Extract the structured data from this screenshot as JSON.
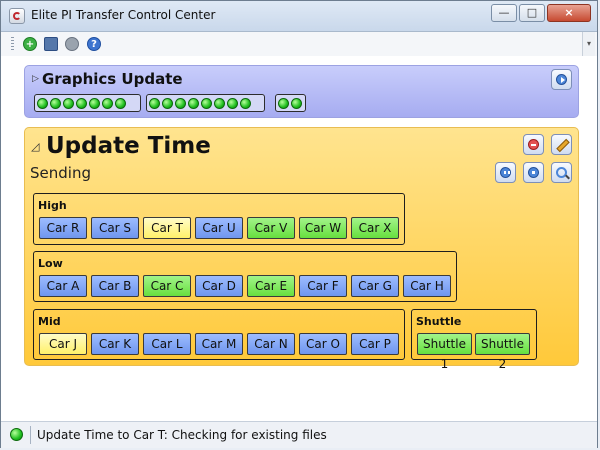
{
  "window": {
    "title": "Elite PI Transfer Control Center",
    "min_label": "—",
    "max_label": "□",
    "close_label": "×"
  },
  "toolbar": {
    "icons": [
      "add-icon",
      "copy-icon",
      "gear-icon",
      "help-icon"
    ],
    "help_glyph": "?",
    "add_glyph": "+"
  },
  "graphics_panel": {
    "title": "Graphics Update",
    "expander_glyph": "▷",
    "dot_groups": [
      7,
      8,
      2
    ],
    "color": "#b0b6f5"
  },
  "update_panel": {
    "title": "Update Time",
    "status": "Sending",
    "expander_glyph": "◿",
    "color": "#ffd24f",
    "groups": {
      "high": {
        "title": "High",
        "cars": [
          {
            "label": "Car R",
            "state": "blue"
          },
          {
            "label": "Car S",
            "state": "blue"
          },
          {
            "label": "Car T",
            "state": "yellow"
          },
          {
            "label": "Car U",
            "state": "blue"
          },
          {
            "label": "Car V",
            "state": "green"
          },
          {
            "label": "Car W",
            "state": "green"
          },
          {
            "label": "Car X",
            "state": "green"
          }
        ]
      },
      "low": {
        "title": "Low",
        "cars": [
          {
            "label": "Car A",
            "state": "blue"
          },
          {
            "label": "Car B",
            "state": "blue"
          },
          {
            "label": "Car C",
            "state": "green"
          },
          {
            "label": "Car D",
            "state": "blue"
          },
          {
            "label": "Car E",
            "state": "green"
          },
          {
            "label": "Car F",
            "state": "blue"
          },
          {
            "label": "Car G",
            "state": "blue"
          },
          {
            "label": "Car H",
            "state": "blue"
          }
        ]
      },
      "mid": {
        "title": "Mid",
        "cars": [
          {
            "label": "Car J",
            "state": "yellow"
          },
          {
            "label": "Car K",
            "state": "blue"
          },
          {
            "label": "Car L",
            "state": "blue"
          },
          {
            "label": "Car M",
            "state": "blue"
          },
          {
            "label": "Car N",
            "state": "blue"
          },
          {
            "label": "Car O",
            "state": "blue"
          },
          {
            "label": "Car P",
            "state": "blue"
          }
        ]
      },
      "shuttle": {
        "title": "Shuttle",
        "cars": [
          {
            "label": "Shuttle 1",
            "state": "green"
          },
          {
            "label": "Shuttle 2",
            "state": "green"
          }
        ]
      }
    }
  },
  "status_bar": {
    "text": "Update Time to Car T: Checking for existing files"
  }
}
